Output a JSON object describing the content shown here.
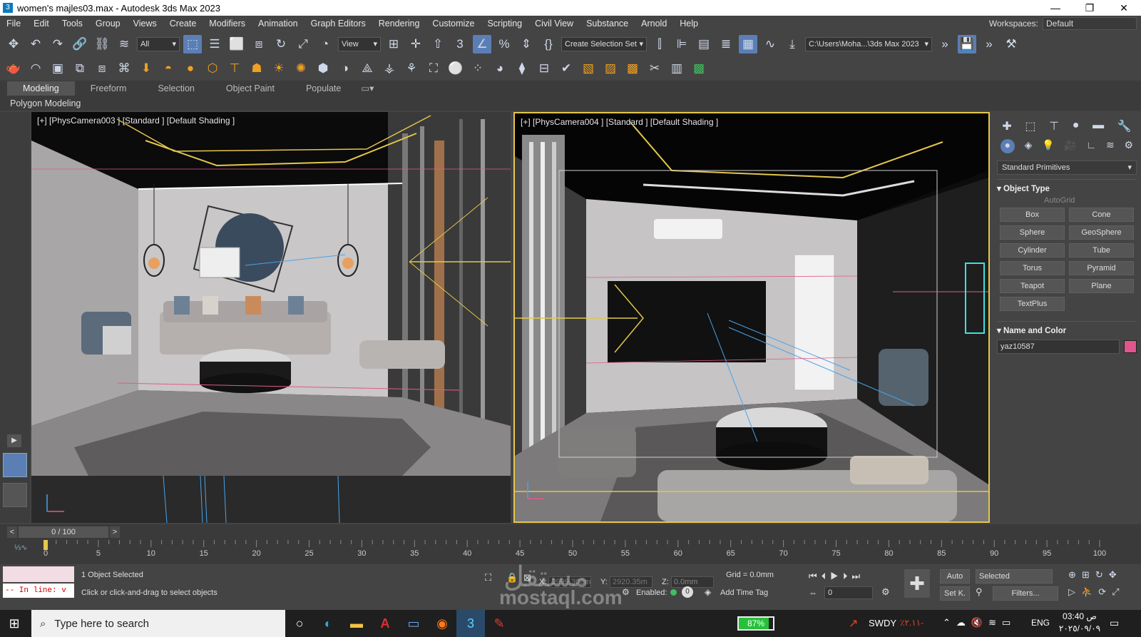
{
  "window": {
    "title": "women's majles03.max - Autodesk 3ds Max 2023",
    "app_icon": "3"
  },
  "menu": [
    "File",
    "Edit",
    "Tools",
    "Group",
    "Views",
    "Create",
    "Modifiers",
    "Animation",
    "Graph Editors",
    "Rendering",
    "Customize",
    "Scripting",
    "Civil View",
    "Substance",
    "Arnold",
    "Help"
  ],
  "workspaces": {
    "label": "Workspaces:",
    "value": "Default"
  },
  "toolbar": {
    "filter_value": "All",
    "refcoord_value": "View",
    "selection_set_value": "Create Selection Set",
    "project_path": "C:\\Users\\Moha...\\3ds Max 2023"
  },
  "ribbon": {
    "tabs": [
      "Modeling",
      "Freeform",
      "Selection",
      "Object Paint",
      "Populate"
    ],
    "active": "Modeling",
    "sub_label": "Polygon Modeling"
  },
  "viewports": {
    "left_label": "[+] [PhysCamera003 ] [Standard ] [Default Shading ]",
    "right_label": "[+] [PhysCamera004 ] [Standard ] [Default Shading ]"
  },
  "command_panel": {
    "category": "Standard Primitives",
    "object_type_title": "Object Type",
    "autogrid_label": "AutoGrid",
    "buttons": [
      "Box",
      "Cone",
      "Sphere",
      "GeoSphere",
      "Cylinder",
      "Tube",
      "Torus",
      "Pyramid",
      "Teapot",
      "Plane",
      "TextPlus"
    ],
    "name_color_title": "Name and Color",
    "object_name": "yaz10587",
    "object_color": "#e0558e"
  },
  "timeline": {
    "frame_display": "0 / 100",
    "ticks": [
      "0",
      "5",
      "10",
      "15",
      "20",
      "25",
      "30",
      "35",
      "40",
      "45",
      "50",
      "55",
      "60",
      "65",
      "70",
      "75",
      "80",
      "85",
      "90",
      "95",
      "100"
    ]
  },
  "status": {
    "selection": "1 Object Selected",
    "prompt": "Click or click-and-drag to select objects",
    "maxscript": "-- In line: v",
    "x_label": "X:",
    "x_value": "2999.308m",
    "y_label": "Y:",
    "y_value": "2920.35m",
    "z_label": "Z:",
    "z_value": "0.0mm",
    "grid": "Grid = 0.0mm",
    "enabled_label": "Enabled:",
    "add_time_tag": "Add Time Tag",
    "auto_key": "Auto",
    "set_key": "Set K.",
    "key_filter": "Selected",
    "filters": "Filters...",
    "frame_value": "0"
  },
  "taskbar": {
    "search_placeholder": "Type here to search",
    "battery": "87%",
    "stock": "SWDY",
    "stock_change": "٪۲.۱۱-",
    "lang": "ENG",
    "time": "03:40 ص",
    "date": "٢٠٢٥/٠٩/٠٩"
  },
  "watermark": {
    "arabic": "مستقل",
    "latin": "mostaql.com"
  }
}
